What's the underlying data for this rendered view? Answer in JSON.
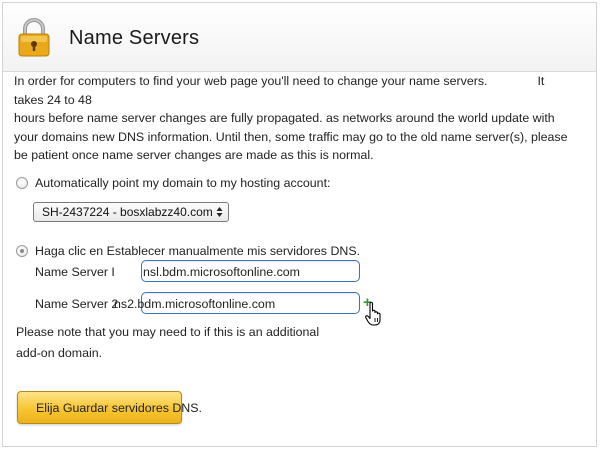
{
  "header": {
    "title": "Name Servers",
    "icon": "lock-icon"
  },
  "intro": {
    "line1a": "In order for computers to find your web page you'll need to change your name servers.",
    "line1b": "It takes 24 to 48",
    "line2": "hours before name server changes are fully propagated. as networks around the world update with",
    "line3": "your domains new DNS information. Until then, some traffic may go to the old name server(s), please",
    "line4": "be patient once name server changes are made as this is normal."
  },
  "option_auto": {
    "label": "Automatically point my domain to my hosting account:",
    "selected": false,
    "select_value": "SH-2437224 - bosxlabzz40.com"
  },
  "option_manual": {
    "label": "Haga clic en Establecer manualmente mis servidores DNS.",
    "selected": true,
    "ns1_label": "Name Server I",
    "ns1_value": "nsl.bdm.microsoftonline.com",
    "ns2_label": "Name Server 2",
    "ns2_value": "ns2.bdm.microsoftonline.com",
    "add_symbol": "+"
  },
  "note": {
    "line1": "Please note that you may need to if this is an additional",
    "line2": "add-on domain."
  },
  "save_button": {
    "label": "Elija Guardar servidores DNS."
  },
  "colors": {
    "button": "#f7c531",
    "input_border": "#3b73b9",
    "plus": "#2e9b2e",
    "lock": "#e6a817"
  }
}
